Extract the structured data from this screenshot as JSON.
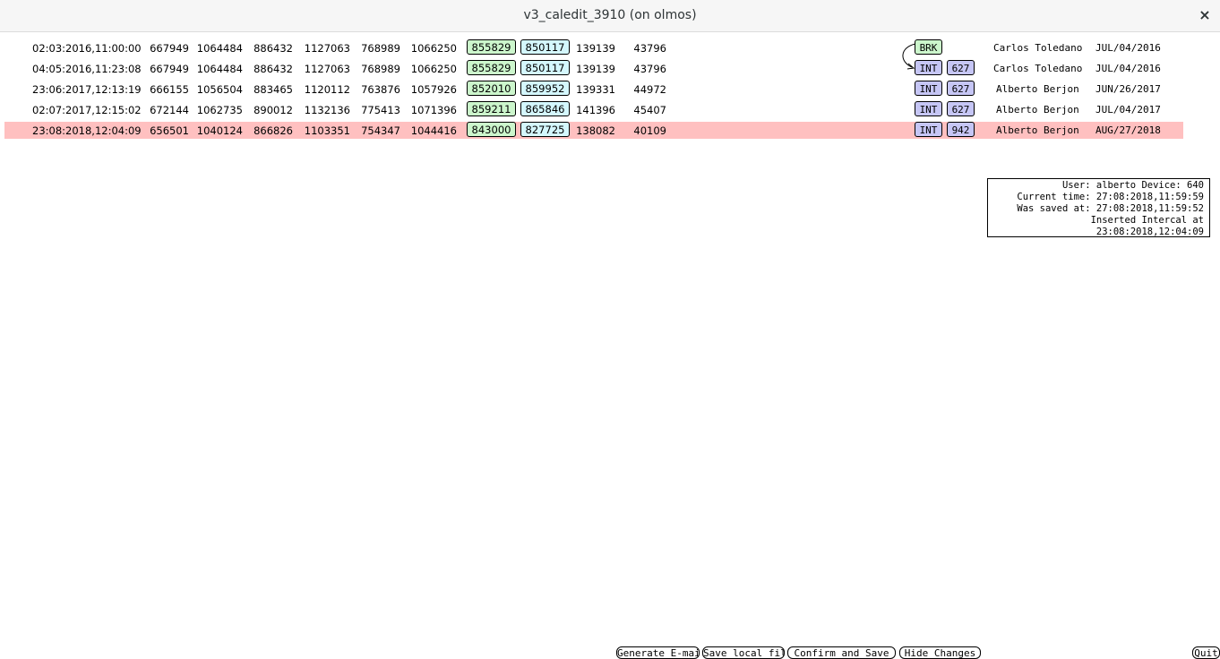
{
  "window": {
    "title": "v3_caledit_3910 (on olmos)",
    "close_label": "×"
  },
  "colors": {
    "selected_row": "#ffc0c0",
    "green_box": "#ccf6cc",
    "cyan_box": "#d4f7fd",
    "blue_box": "#c6c6f5"
  },
  "rows": [
    {
      "date": "02:03:2016,11:00:00",
      "c1": "667949",
      "c2": "1064484",
      "c3": "886432",
      "c4": "1127063",
      "c5": "768989",
      "c6": "1066250",
      "g": "855829",
      "b": "850117",
      "c7": "139139",
      "c8": "43796",
      "tag": "BRK",
      "num": "",
      "user": "Carlos Toledano",
      "saved": "JUL/04/2016",
      "selected": false
    },
    {
      "date": "04:05:2016,11:23:08",
      "c1": "667949",
      "c2": "1064484",
      "c3": "886432",
      "c4": "1127063",
      "c5": "768989",
      "c6": "1066250",
      "g": "855829",
      "b": "850117",
      "c7": "139139",
      "c8": "43796",
      "tag": "INT",
      "num": "627",
      "user": "Carlos Toledano",
      "saved": "JUL/04/2016",
      "selected": false
    },
    {
      "date": "23:06:2017,12:13:19",
      "c1": "666155",
      "c2": "1056504",
      "c3": "883465",
      "c4": "1120112",
      "c5": "763876",
      "c6": "1057926",
      "g": "852010",
      "b": "859952",
      "c7": "139331",
      "c8": "44972",
      "tag": "INT",
      "num": "627",
      "user": "Alberto Berjon",
      "saved": "JUN/26/2017",
      "selected": false
    },
    {
      "date": "02:07:2017,12:15:02",
      "c1": "672144",
      "c2": "1062735",
      "c3": "890012",
      "c4": "1132136",
      "c5": "775413",
      "c6": "1071396",
      "g": "859211",
      "b": "865846",
      "c7": "141396",
      "c8": "45407",
      "tag": "INT",
      "num": "627",
      "user": "Alberto Berjon",
      "saved": "JUL/04/2017",
      "selected": false
    },
    {
      "date": "23:08:2018,12:04:09",
      "c1": "656501",
      "c2": "1040124",
      "c3": "866826",
      "c4": "1103351",
      "c5": "754347",
      "c6": "1044416",
      "g": "843000",
      "b": "827725",
      "c7": "138082",
      "c8": "40109",
      "tag": "INT",
      "num": "942",
      "user": "Alberto Berjon",
      "saved": "AUG/27/2018",
      "selected": true
    }
  ],
  "info": {
    "line1": "User: alberto Device: 640",
    "line2": "Current time: 27:08:2018,11:59:59",
    "line3": "Was saved at: 27:08:2018,11:59:52",
    "line4": "Inserted Intercal at 23:08:2018,12:04:09"
  },
  "buttons": {
    "email": "Generate E-mail",
    "save_local": "Save local file",
    "confirm": "Confirm and Save",
    "hide": "Hide Changes",
    "quit": "Quit"
  }
}
